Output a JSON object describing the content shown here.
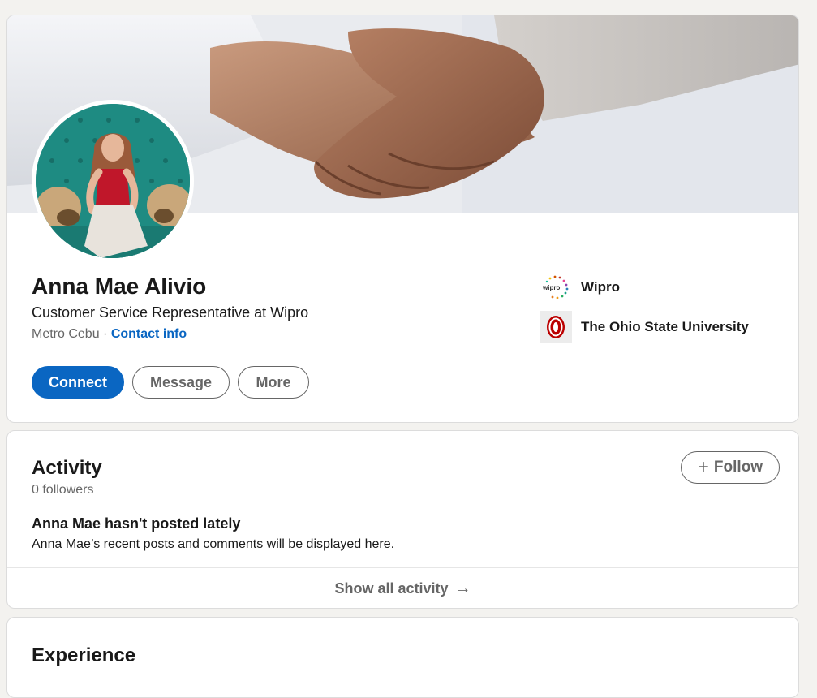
{
  "profile": {
    "name": "Anna Mae Alivio",
    "headline": "Customer Service Representative at Wipro",
    "location": "Metro Cebu",
    "location_separator": " · ",
    "contact_info_label": "Contact info",
    "buttons": {
      "connect": "Connect",
      "message": "Message",
      "more": "More"
    },
    "organizations": [
      {
        "name": "Wipro",
        "logo_text": "wipro",
        "icon": "wipro-logo"
      },
      {
        "name": "The Ohio State University",
        "icon": "ohio-state-logo"
      }
    ]
  },
  "activity": {
    "title": "Activity",
    "followers": "0 followers",
    "follow_label": "Follow",
    "empty_title": "Anna Mae hasn't posted lately",
    "empty_desc": "Anna Mae’s recent posts and comments will be displayed here.",
    "show_all": "Show all activity"
  },
  "experience": {
    "title": "Experience"
  },
  "colors": {
    "accent": "#0a66c2",
    "page_bg": "#f3f2ef",
    "osu_red": "#bb0000"
  }
}
